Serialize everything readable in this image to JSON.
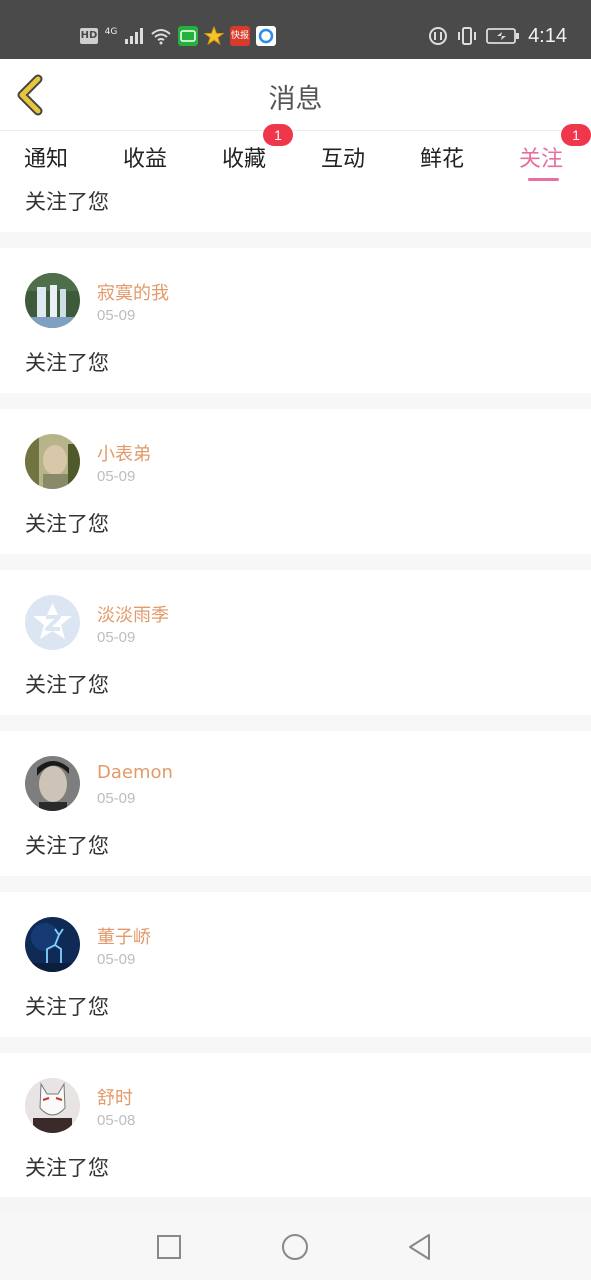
{
  "status_bar": {
    "left_indicators": [
      "HD",
      "4G",
      "signal-icon",
      "wifi-icon",
      "iqiyi-app-icon",
      "star-app-icon",
      "kuaibao-app-icon",
      "browser-app-icon"
    ],
    "hd": "HD",
    "network": "4G",
    "app_kuaibao": "快报",
    "time": "4:14"
  },
  "header": {
    "title": "消息",
    "back_icon": "chevron-left-icon",
    "accent": "#e8c63a"
  },
  "tabs": {
    "items": [
      {
        "label": "通知"
      },
      {
        "label": "收益"
      },
      {
        "label": "收藏",
        "badge": "1"
      },
      {
        "label": "互动"
      },
      {
        "label": "鲜花"
      },
      {
        "label": "关注",
        "badge": "1",
        "active": true
      }
    ],
    "active_color": "#e86fa0",
    "badge_color": "#f0364a"
  },
  "partial_top": {
    "message": "关注了您"
  },
  "follows": [
    {
      "name": "寂寞的我",
      "date": "05-09",
      "message": "关注了您"
    },
    {
      "name": "小表弟",
      "date": "05-09",
      "message": "关注了您"
    },
    {
      "name": "淡淡雨季",
      "date": "05-09",
      "message": "关注了您"
    },
    {
      "name": "Daemon",
      "date": "05-09",
      "message": "关注了您"
    },
    {
      "name": "董子峤",
      "date": "05-09",
      "message": "关注了您"
    },
    {
      "name": "舒时",
      "date": "05-08",
      "message": "关注了您"
    }
  ],
  "nav_bar": {
    "buttons": [
      "recents-square-icon",
      "home-circle-icon",
      "back-triangle-icon"
    ]
  }
}
